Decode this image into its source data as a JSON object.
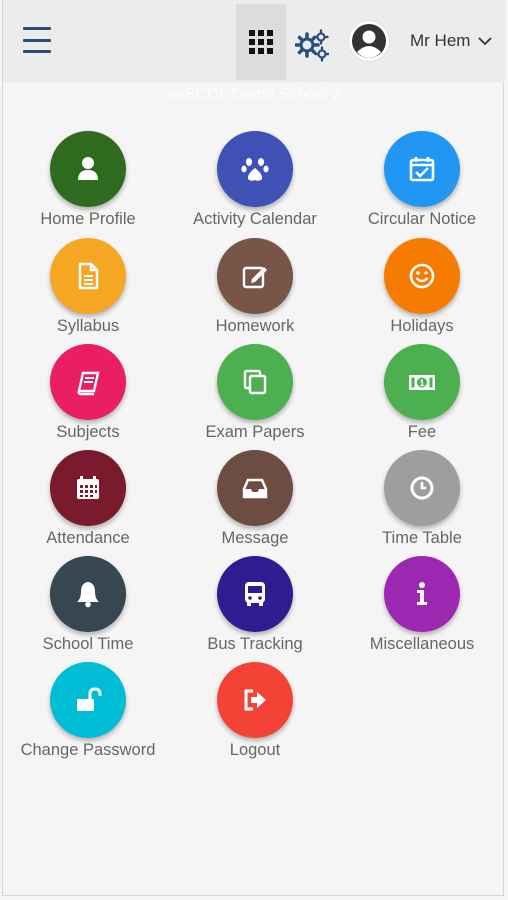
{
  "header": {
    "menu_icon": "hamburger-icon",
    "apps_icon": "grid-icon",
    "settings_icon": "gears-icon",
    "user_name": "Mr Hem",
    "avatar_icon": "user-avatar-icon",
    "dropdown_icon": "chevron-down-icon",
    "colors": {
      "bar": "#ececec",
      "icon": "#2b4c7e"
    }
  },
  "school": {
    "name": "eeSCOL Demo School 2"
  },
  "menu": {
    "items": [
      {
        "label": "Home Profile",
        "icon": "user-icon",
        "color": "#2e6b1e"
      },
      {
        "label": "Activity Calendar",
        "icon": "paw-icon",
        "color": "#3f51b5"
      },
      {
        "label": "Circular Notice",
        "icon": "calendar-check-icon",
        "color": "#2196f3"
      },
      {
        "label": "Syllabus",
        "icon": "document-icon",
        "color": "#f5a623"
      },
      {
        "label": "Homework",
        "icon": "edit-icon",
        "color": "#795548"
      },
      {
        "label": "Holidays",
        "icon": "smile-icon",
        "color": "#f57c00"
      },
      {
        "label": "Subjects",
        "icon": "book-icon",
        "color": "#e91e63"
      },
      {
        "label": "Exam Papers",
        "icon": "copy-icon",
        "color": "#4caf50"
      },
      {
        "label": "Fee",
        "icon": "money-icon",
        "color": "#4caf50"
      },
      {
        "label": "Attendance",
        "icon": "calendar-icon",
        "color": "#7b1a2c"
      },
      {
        "label": "Message",
        "icon": "inbox-icon",
        "color": "#6d4c41"
      },
      {
        "label": "Time Table",
        "icon": "clock-icon",
        "color": "#9e9e9e"
      },
      {
        "label": "School Time",
        "icon": "bell-icon",
        "color": "#37474f"
      },
      {
        "label": "Bus Tracking",
        "icon": "bus-icon",
        "color": "#311b92"
      },
      {
        "label": "Miscellaneous",
        "icon": "info-icon",
        "color": "#9c27b0"
      },
      {
        "label": "Change Password",
        "icon": "unlock-icon",
        "color": "#00bcd4"
      },
      {
        "label": "Logout",
        "icon": "logout-icon",
        "color": "#f44336"
      }
    ]
  }
}
